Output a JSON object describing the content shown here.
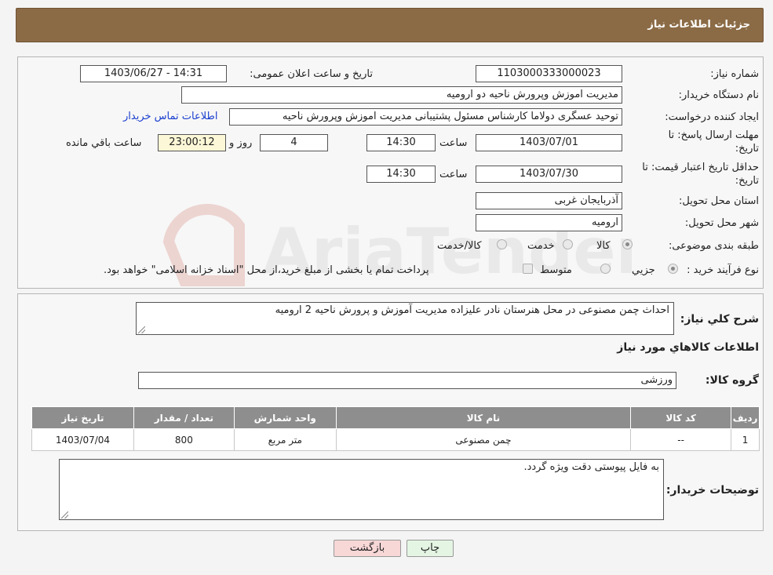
{
  "header": {
    "title": "جزئیات اطلاعات نیاز"
  },
  "form": {
    "need_number": {
      "label": "شماره نیاز:",
      "value": "1103000333000023"
    },
    "announce_datetime": {
      "label": "تاریخ و ساعت اعلان عمومی:",
      "value": "1403/06/27 - 14:31"
    },
    "buyer_org": {
      "label": "نام دستگاه خریدار:",
      "value": "مدیریت اموزش وپرورش ناحیه دو ارومیه"
    },
    "requester": {
      "label": "ایجاد کننده درخواست:",
      "value": "توحید عسگری دولاما کارشناس مسئول پشتیبانی مدیریت اموزش وپرورش ناحیه",
      "contact_link": "اطلاعات تماس خریدار"
    },
    "response_deadline": {
      "label_line1": "مهلت ارسال پاسخ: تا",
      "label_line2": "تاریخ:",
      "date": "1403/07/01",
      "time_label": "ساعت",
      "time": "14:30",
      "days": "4",
      "days_label": "روز و",
      "remaining": "23:00:12",
      "remaining_label": "ساعت باقي مانده"
    },
    "price_validity": {
      "label_line1": "حداقل تاریخ اعتبار قیمت: تا",
      "label_line2": "تاریخ:",
      "date": "1403/07/30",
      "time_label": "ساعت",
      "time": "14:30"
    },
    "province": {
      "label": "استان محل تحویل:",
      "value": "آذربایجان غربی"
    },
    "city": {
      "label": "شهر محل تحویل:",
      "value": "ارومیه"
    },
    "category": {
      "label": "طبقه بندی موضوعی:",
      "options": [
        "کالا",
        "خدمت",
        "کالا/خدمت"
      ],
      "selected": "کالا"
    },
    "purchase_type": {
      "label": "نوع فرآیند خرید :",
      "options": [
        "جزیي",
        "متوسط"
      ],
      "selected": "جزیي",
      "note": "پرداخت تمام یا بخشی از مبلغ خرید،از محل \"اسناد خزانه اسلامی\" خواهد بود."
    }
  },
  "details": {
    "summary_label": "شرح کلي نياز:",
    "summary_value": "احداث چمن مصنوعی در محل هنرستان نادر علیزاده مدیریت آموزش و پرورش ناحیه 2 ارومیه",
    "goods_info_title": "اطلاعات کالاهاي مورد نياز",
    "goods_group_label": "گروه کالا:",
    "goods_group_value": "ورزشی",
    "table": {
      "headers": [
        "رديف",
        "کد کالا",
        "نام کالا",
        "واحد شمارش",
        "تعداد / مقدار",
        "تاریخ نیاز"
      ],
      "rows": [
        [
          "1",
          "--",
          "چمن مصنوعی",
          "متر مربع",
          "800",
          "1403/07/04"
        ]
      ]
    },
    "buyer_notes_label": "توضیحات خریدار:",
    "buyer_notes_value": "به فایل پیوستی دقت ویژه گردد."
  },
  "buttons": {
    "print": "چاپ",
    "back": "بازگشت"
  },
  "watermark": {
    "text": "AriaTender.neT"
  },
  "colors": {
    "header_bg": "#8b6b46",
    "table_header_bg": "#8e8e8e",
    "back_button_bg": "#f8d7d7",
    "print_button_bg": "#e4f5e4",
    "link": "#1a3fcf"
  }
}
